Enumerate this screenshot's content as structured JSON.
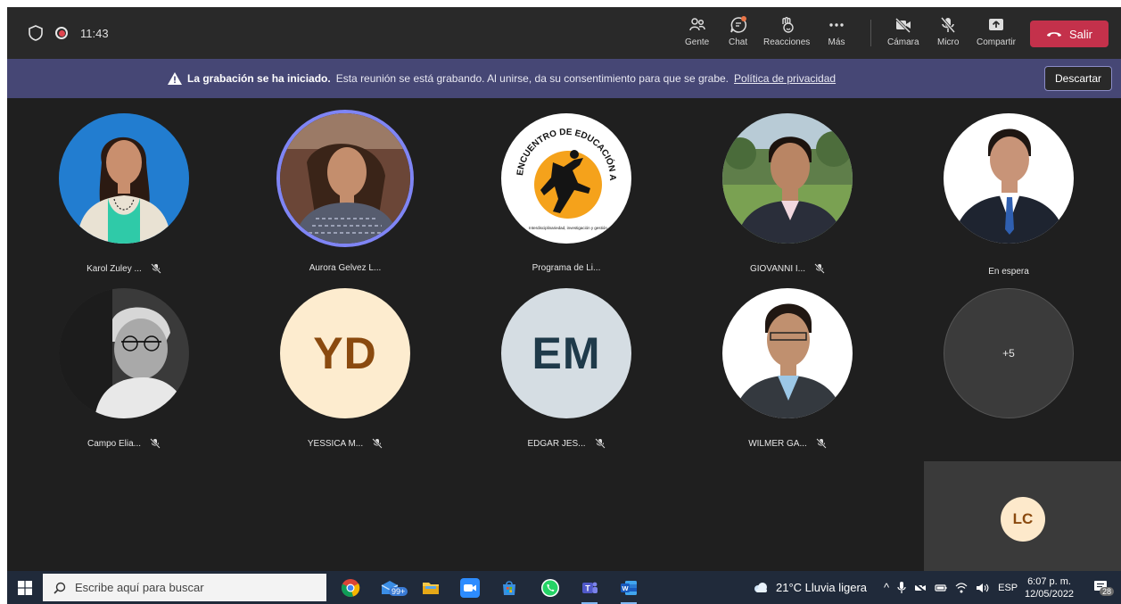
{
  "topbar": {
    "time": "11:43",
    "buttons": [
      {
        "label": "Gente"
      },
      {
        "label": "Chat"
      },
      {
        "label": "Reacciones"
      },
      {
        "label": "Más"
      },
      {
        "label": "Cámara"
      },
      {
        "label": "Micro"
      },
      {
        "label": "Compartir"
      }
    ],
    "leave_label": "Salir"
  },
  "banner": {
    "title": "La grabación se ha iniciado.",
    "message": "Esta reunión se está grabando. Al unirse, da su consentimiento para que se grabe.",
    "link": "Política de privacidad",
    "dismiss_label": "Descartar"
  },
  "participants": [
    {
      "name": "Karol Zuley ...",
      "muted": true
    },
    {
      "name": "Aurora Gelvez L...",
      "muted": false
    },
    {
      "name": "Programa de Li...",
      "muted": false
    },
    {
      "name": "GIOVANNI I...",
      "muted": true
    },
    {
      "name": "En espera",
      "muted": false
    },
    {
      "name": "Campo Elia...",
      "muted": true
    },
    {
      "name": "YESSICA M...",
      "initials": "YD",
      "muted": true
    },
    {
      "name": "EDGAR JES...",
      "initials": "EM",
      "muted": true
    },
    {
      "name": "WILMER GA...",
      "muted": true
    },
    {
      "name": "",
      "overflow": "+5"
    }
  ],
  "logo_text": "ENCUENTRO DE EDUCACIÓN ARTÍSTICA",
  "logo_subtext": "Interdisciplinariedad, investigación y gestión",
  "self_view": {
    "initials": "LC"
  },
  "taskbar": {
    "search_placeholder": "Escribe aquí para buscar",
    "mail_badge": "99+",
    "weather": "21°C  Lluvia ligera",
    "language": "ESP",
    "time": "6:07 p. m.",
    "date": "12/05/2022",
    "notifications": "28"
  },
  "colors": {
    "meeting_bg": "#1f1f1f",
    "topbar_bg": "#292929",
    "banner_bg": "#464775",
    "leave_red": "#c4314b",
    "speaking_ring": "#7f85f5",
    "yd_bg": "#fdeccf",
    "yd_fg": "#8a4a0f",
    "em_bg": "#d5dde3",
    "em_fg": "#1f3a4a"
  }
}
